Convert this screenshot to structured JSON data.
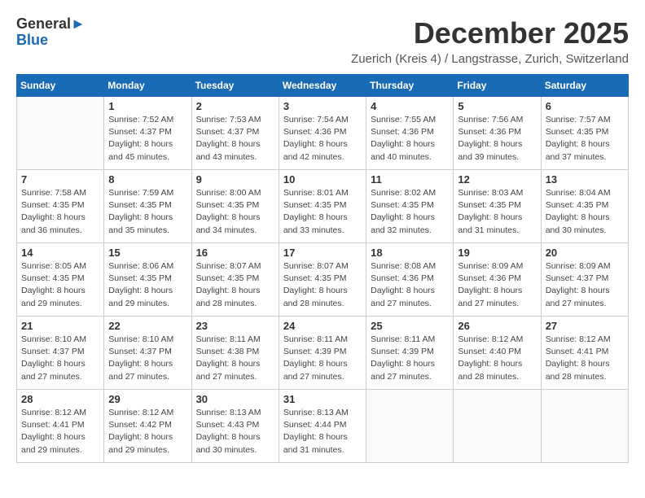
{
  "header": {
    "logo_general": "General",
    "logo_blue": "Blue",
    "month_title": "December 2025",
    "subtitle": "Zuerich (Kreis 4) / Langstrasse, Zurich, Switzerland"
  },
  "days_of_week": [
    "Sunday",
    "Monday",
    "Tuesday",
    "Wednesday",
    "Thursday",
    "Friday",
    "Saturday"
  ],
  "weeks": [
    [
      {
        "day": "",
        "info": ""
      },
      {
        "day": "1",
        "info": "Sunrise: 7:52 AM\nSunset: 4:37 PM\nDaylight: 8 hours\nand 45 minutes."
      },
      {
        "day": "2",
        "info": "Sunrise: 7:53 AM\nSunset: 4:37 PM\nDaylight: 8 hours\nand 43 minutes."
      },
      {
        "day": "3",
        "info": "Sunrise: 7:54 AM\nSunset: 4:36 PM\nDaylight: 8 hours\nand 42 minutes."
      },
      {
        "day": "4",
        "info": "Sunrise: 7:55 AM\nSunset: 4:36 PM\nDaylight: 8 hours\nand 40 minutes."
      },
      {
        "day": "5",
        "info": "Sunrise: 7:56 AM\nSunset: 4:36 PM\nDaylight: 8 hours\nand 39 minutes."
      },
      {
        "day": "6",
        "info": "Sunrise: 7:57 AM\nSunset: 4:35 PM\nDaylight: 8 hours\nand 37 minutes."
      }
    ],
    [
      {
        "day": "7",
        "info": "Sunrise: 7:58 AM\nSunset: 4:35 PM\nDaylight: 8 hours\nand 36 minutes."
      },
      {
        "day": "8",
        "info": "Sunrise: 7:59 AM\nSunset: 4:35 PM\nDaylight: 8 hours\nand 35 minutes."
      },
      {
        "day": "9",
        "info": "Sunrise: 8:00 AM\nSunset: 4:35 PM\nDaylight: 8 hours\nand 34 minutes."
      },
      {
        "day": "10",
        "info": "Sunrise: 8:01 AM\nSunset: 4:35 PM\nDaylight: 8 hours\nand 33 minutes."
      },
      {
        "day": "11",
        "info": "Sunrise: 8:02 AM\nSunset: 4:35 PM\nDaylight: 8 hours\nand 32 minutes."
      },
      {
        "day": "12",
        "info": "Sunrise: 8:03 AM\nSunset: 4:35 PM\nDaylight: 8 hours\nand 31 minutes."
      },
      {
        "day": "13",
        "info": "Sunrise: 8:04 AM\nSunset: 4:35 PM\nDaylight: 8 hours\nand 30 minutes."
      }
    ],
    [
      {
        "day": "14",
        "info": "Sunrise: 8:05 AM\nSunset: 4:35 PM\nDaylight: 8 hours\nand 29 minutes."
      },
      {
        "day": "15",
        "info": "Sunrise: 8:06 AM\nSunset: 4:35 PM\nDaylight: 8 hours\nand 29 minutes."
      },
      {
        "day": "16",
        "info": "Sunrise: 8:07 AM\nSunset: 4:35 PM\nDaylight: 8 hours\nand 28 minutes."
      },
      {
        "day": "17",
        "info": "Sunrise: 8:07 AM\nSunset: 4:35 PM\nDaylight: 8 hours\nand 28 minutes."
      },
      {
        "day": "18",
        "info": "Sunrise: 8:08 AM\nSunset: 4:36 PM\nDaylight: 8 hours\nand 27 minutes."
      },
      {
        "day": "19",
        "info": "Sunrise: 8:09 AM\nSunset: 4:36 PM\nDaylight: 8 hours\nand 27 minutes."
      },
      {
        "day": "20",
        "info": "Sunrise: 8:09 AM\nSunset: 4:37 PM\nDaylight: 8 hours\nand 27 minutes."
      }
    ],
    [
      {
        "day": "21",
        "info": "Sunrise: 8:10 AM\nSunset: 4:37 PM\nDaylight: 8 hours\nand 27 minutes."
      },
      {
        "day": "22",
        "info": "Sunrise: 8:10 AM\nSunset: 4:37 PM\nDaylight: 8 hours\nand 27 minutes."
      },
      {
        "day": "23",
        "info": "Sunrise: 8:11 AM\nSunset: 4:38 PM\nDaylight: 8 hours\nand 27 minutes."
      },
      {
        "day": "24",
        "info": "Sunrise: 8:11 AM\nSunset: 4:39 PM\nDaylight: 8 hours\nand 27 minutes."
      },
      {
        "day": "25",
        "info": "Sunrise: 8:11 AM\nSunset: 4:39 PM\nDaylight: 8 hours\nand 27 minutes."
      },
      {
        "day": "26",
        "info": "Sunrise: 8:12 AM\nSunset: 4:40 PM\nDaylight: 8 hours\nand 28 minutes."
      },
      {
        "day": "27",
        "info": "Sunrise: 8:12 AM\nSunset: 4:41 PM\nDaylight: 8 hours\nand 28 minutes."
      }
    ],
    [
      {
        "day": "28",
        "info": "Sunrise: 8:12 AM\nSunset: 4:41 PM\nDaylight: 8 hours\nand 29 minutes."
      },
      {
        "day": "29",
        "info": "Sunrise: 8:12 AM\nSunset: 4:42 PM\nDaylight: 8 hours\nand 29 minutes."
      },
      {
        "day": "30",
        "info": "Sunrise: 8:13 AM\nSunset: 4:43 PM\nDaylight: 8 hours\nand 30 minutes."
      },
      {
        "day": "31",
        "info": "Sunrise: 8:13 AM\nSunset: 4:44 PM\nDaylight: 8 hours\nand 31 minutes."
      },
      {
        "day": "",
        "info": ""
      },
      {
        "day": "",
        "info": ""
      },
      {
        "day": "",
        "info": ""
      }
    ]
  ]
}
